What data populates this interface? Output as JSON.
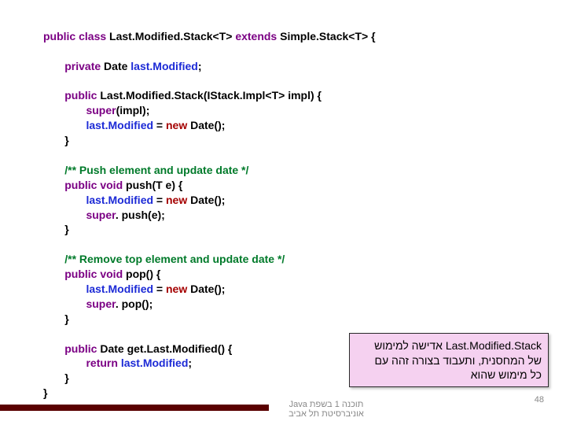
{
  "code": {
    "l01a": "public class ",
    "l01b": "Last.Modified.Stack<T> ",
    "l01c": "extends ",
    "l01d": "Simple.Stack<T> {",
    "l02a": "private ",
    "l02b": "Date ",
    "l02c": "last.Modified",
    "l02d": ";",
    "l03a": "public ",
    "l03b": "Last.Modified.Stack(IStack.Impl<T> impl) {",
    "l04a": "super",
    "l04b": "(impl);",
    "l05a": "last.Modified",
    "l05b": " = ",
    "l05c": "new ",
    "l05d": "Date();",
    "l06": "}",
    "l07": "/** Push element and update date */",
    "l08a": "public void ",
    "l08b": "push(T e) {",
    "l09a": "last.Modified",
    "l09b": " = ",
    "l09c": "new ",
    "l09d": "Date();",
    "l10a": "super",
    "l10b": ". push(e);",
    "l11": "}",
    "l12": "/** Remove top element and update date */",
    "l13a": "public void ",
    "l13b": "pop() {",
    "l14a": "last.Modified",
    "l14b": " = ",
    "l14c": "new ",
    "l14d": "Date();",
    "l15a": "super",
    "l15b": ". pop();",
    "l16": "}",
    "l17a": "public ",
    "l17b": "Date get.Last.Modified() {",
    "l18a": "return ",
    "l18b": "last.Modified",
    "l18c": ";",
    "l19": "}",
    "l20": "}"
  },
  "note": {
    "line1_ltr": "Last.Modified.Stack",
    "line1_rtl": " אדישה למימוש",
    "line2": "של המחסנית, ותעבוד בצורה זהה עם",
    "line3": "כל מימוש שהוא"
  },
  "footer": {
    "line1": "תוכנה 1 בשפת Java",
    "line2": "אוניברסיטת תל אביב"
  },
  "page": "48"
}
